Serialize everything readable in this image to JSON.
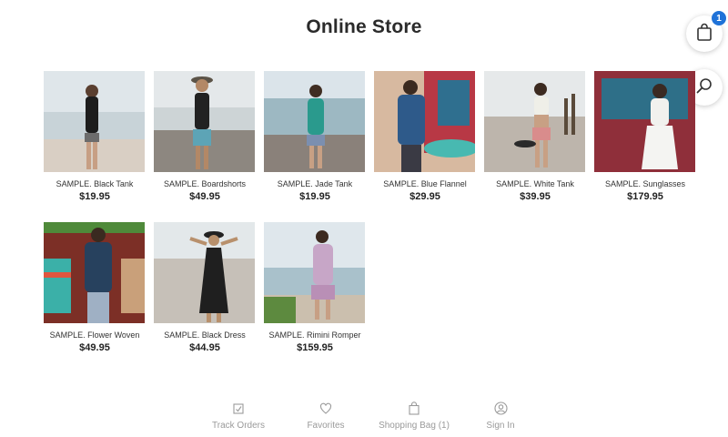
{
  "header": {
    "title": "Online Store"
  },
  "cart": {
    "icon": "shopping-bag-icon",
    "badge_count": "1"
  },
  "search": {
    "icon": "search-icon"
  },
  "products": [
    {
      "name": "SAMPLE. Black Tank",
      "price": "$19.95"
    },
    {
      "name": "SAMPLE. Boardshorts",
      "price": "$49.95"
    },
    {
      "name": "SAMPLE. Jade Tank",
      "price": "$19.95"
    },
    {
      "name": "SAMPLE. Blue Flannel",
      "price": "$29.95"
    },
    {
      "name": "SAMPLE. White Tank",
      "price": "$39.95"
    },
    {
      "name": "SAMPLE. Sunglasses",
      "price": "$179.95"
    },
    {
      "name": "SAMPLE. Flower Woven",
      "price": "$49.95"
    },
    {
      "name": "SAMPLE. Black Dress",
      "price": "$44.95"
    },
    {
      "name": "SAMPLE. Rimini Romper",
      "price": "$159.95"
    }
  ],
  "bottom_nav": [
    {
      "label": "Track Orders",
      "icon": "track-orders-icon"
    },
    {
      "label": "Favorites",
      "icon": "heart-icon"
    },
    {
      "label": "Shopping Bag (1)",
      "icon": "shopping-bag-icon"
    },
    {
      "label": "Sign In",
      "icon": "user-icon"
    }
  ],
  "colors": {
    "accent": "#1f72d8",
    "text": "#222222",
    "muted": "#9a9a9a"
  }
}
